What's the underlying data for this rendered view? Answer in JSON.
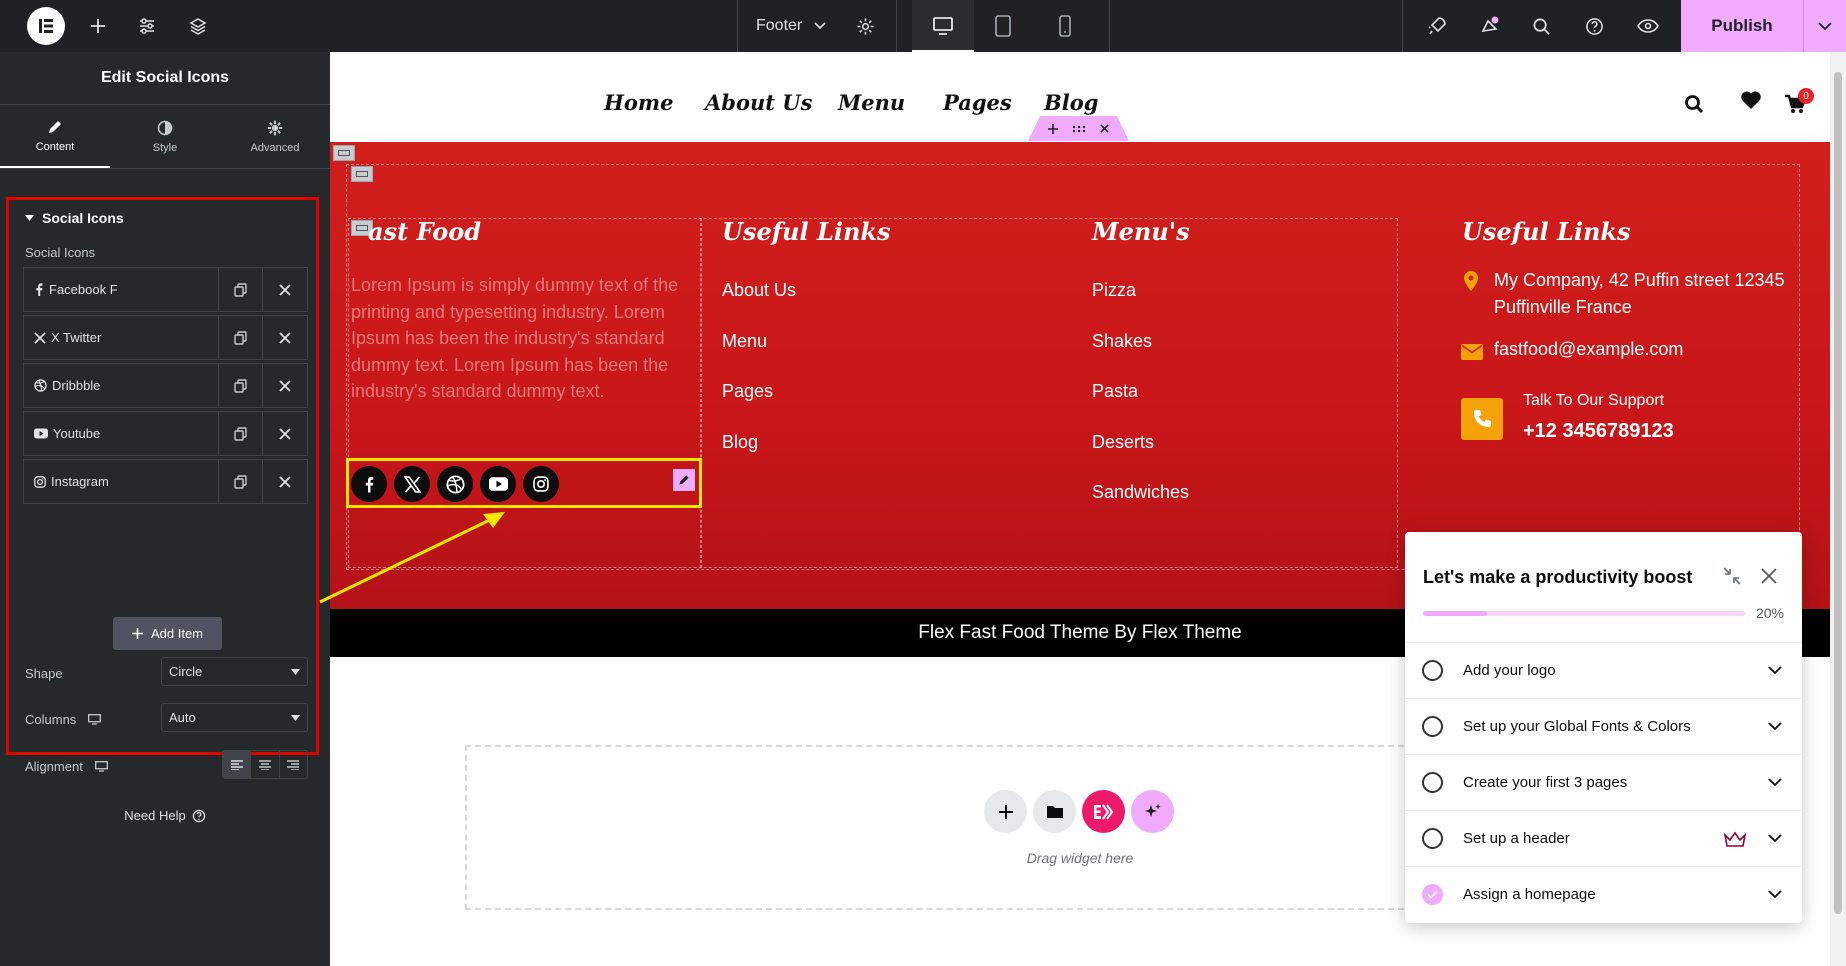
{
  "topbar": {
    "document_title": "Footer",
    "publish_label": "Publish"
  },
  "panel": {
    "title": "Edit Social Icons",
    "tabs": [
      {
        "label": "Content",
        "active": true
      },
      {
        "label": "Style",
        "active": false
      },
      {
        "label": "Advanced",
        "active": false
      }
    ],
    "section_title": "Social Icons",
    "repeater_label": "Social Icons",
    "items": [
      {
        "label": "Facebook F",
        "icon": "facebook-f-icon"
      },
      {
        "label": "X Twitter",
        "icon": "x-twitter-icon"
      },
      {
        "label": "Dribbble",
        "icon": "dribbble-icon"
      },
      {
        "label": "Youtube",
        "icon": "youtube-icon"
      },
      {
        "label": "Instagram",
        "icon": "instagram-icon"
      }
    ],
    "add_item_label": "Add Item",
    "shape_label": "Shape",
    "shape_value": "Circle",
    "columns_label": "Columns",
    "columns_value": "Auto",
    "alignment_label": "Alignment",
    "need_help_label": "Need Help"
  },
  "site": {
    "nav": [
      "Home",
      "About Us",
      "Menu",
      "Pages",
      "Blog"
    ],
    "cart_count": "0",
    "col1_title": "ast Food",
    "col1_text": "Lorem Ipsum is simply dummy text of the printing and typesetting industry. Lorem Ipsum has been the industry's standard dummy text. Lorem Ipsum has been the industry's standard dummy text.",
    "col2_title": "Useful Links",
    "col2_links": [
      "About Us",
      "Menu",
      "Pages",
      "Blog"
    ],
    "col3_title": "Menu's",
    "col3_links": [
      "Pizza",
      "Shakes",
      "Pasta",
      "Deserts",
      "Sandwiches"
    ],
    "col4_title": "Useful Links",
    "address": "My Company, 42 Puffin street 12345 Puffinville France",
    "email": "fastfood@example.com",
    "support_label": "Talk To Our Support",
    "phone": "+12 3456789123",
    "copyright": "Flex Fast Food Theme By Flex Theme",
    "drop_label": "Drag widget here"
  },
  "checklist": {
    "title": "Let's make a productivity boost",
    "progress_percent": 20,
    "progress_label": "20%",
    "items": [
      {
        "label": "Add your logo",
        "done": false
      },
      {
        "label": "Set up your Global Fonts & Colors",
        "done": false
      },
      {
        "label": "Create your first 3 pages",
        "done": false
      },
      {
        "label": "Set up a header",
        "done": false,
        "pro": true
      },
      {
        "label": "Assign a homepage",
        "done": true
      }
    ]
  },
  "colors": {
    "accent_pink": "#f0abfc",
    "footer_red": "#d21f1c",
    "highlight_yellow": "#ffe600",
    "panel_outline_red": "#e00000",
    "icon_orange": "#f5a20a"
  }
}
